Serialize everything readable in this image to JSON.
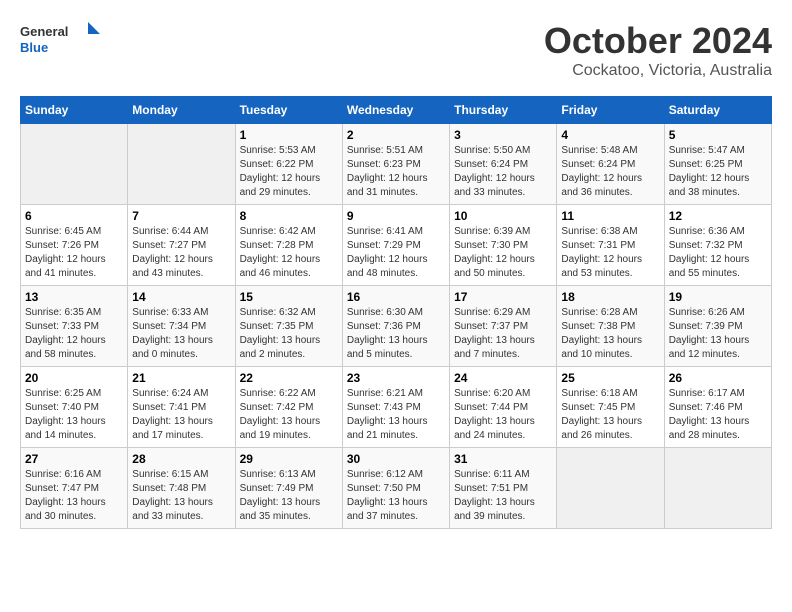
{
  "logo": {
    "line1": "General",
    "line2": "Blue"
  },
  "title": "October 2024",
  "subtitle": "Cockatoo, Victoria, Australia",
  "headers": [
    "Sunday",
    "Monday",
    "Tuesday",
    "Wednesday",
    "Thursday",
    "Friday",
    "Saturday"
  ],
  "weeks": [
    [
      {
        "day": "",
        "info": ""
      },
      {
        "day": "",
        "info": ""
      },
      {
        "day": "1",
        "sunrise": "5:53 AM",
        "sunset": "6:22 PM",
        "daylight": "12 hours and 29 minutes."
      },
      {
        "day": "2",
        "sunrise": "5:51 AM",
        "sunset": "6:23 PM",
        "daylight": "12 hours and 31 minutes."
      },
      {
        "day": "3",
        "sunrise": "5:50 AM",
        "sunset": "6:24 PM",
        "daylight": "12 hours and 33 minutes."
      },
      {
        "day": "4",
        "sunrise": "5:48 AM",
        "sunset": "6:24 PM",
        "daylight": "12 hours and 36 minutes."
      },
      {
        "day": "5",
        "sunrise": "5:47 AM",
        "sunset": "6:25 PM",
        "daylight": "12 hours and 38 minutes."
      }
    ],
    [
      {
        "day": "6",
        "sunrise": "6:45 AM",
        "sunset": "7:26 PM",
        "daylight": "12 hours and 41 minutes."
      },
      {
        "day": "7",
        "sunrise": "6:44 AM",
        "sunset": "7:27 PM",
        "daylight": "12 hours and 43 minutes."
      },
      {
        "day": "8",
        "sunrise": "6:42 AM",
        "sunset": "7:28 PM",
        "daylight": "12 hours and 46 minutes."
      },
      {
        "day": "9",
        "sunrise": "6:41 AM",
        "sunset": "7:29 PM",
        "daylight": "12 hours and 48 minutes."
      },
      {
        "day": "10",
        "sunrise": "6:39 AM",
        "sunset": "7:30 PM",
        "daylight": "12 hours and 50 minutes."
      },
      {
        "day": "11",
        "sunrise": "6:38 AM",
        "sunset": "7:31 PM",
        "daylight": "12 hours and 53 minutes."
      },
      {
        "day": "12",
        "sunrise": "6:36 AM",
        "sunset": "7:32 PM",
        "daylight": "12 hours and 55 minutes."
      }
    ],
    [
      {
        "day": "13",
        "sunrise": "6:35 AM",
        "sunset": "7:33 PM",
        "daylight": "12 hours and 58 minutes."
      },
      {
        "day": "14",
        "sunrise": "6:33 AM",
        "sunset": "7:34 PM",
        "daylight": "13 hours and 0 minutes."
      },
      {
        "day": "15",
        "sunrise": "6:32 AM",
        "sunset": "7:35 PM",
        "daylight": "13 hours and 2 minutes."
      },
      {
        "day": "16",
        "sunrise": "6:30 AM",
        "sunset": "7:36 PM",
        "daylight": "13 hours and 5 minutes."
      },
      {
        "day": "17",
        "sunrise": "6:29 AM",
        "sunset": "7:37 PM",
        "daylight": "13 hours and 7 minutes."
      },
      {
        "day": "18",
        "sunrise": "6:28 AM",
        "sunset": "7:38 PM",
        "daylight": "13 hours and 10 minutes."
      },
      {
        "day": "19",
        "sunrise": "6:26 AM",
        "sunset": "7:39 PM",
        "daylight": "13 hours and 12 minutes."
      }
    ],
    [
      {
        "day": "20",
        "sunrise": "6:25 AM",
        "sunset": "7:40 PM",
        "daylight": "13 hours and 14 minutes."
      },
      {
        "day": "21",
        "sunrise": "6:24 AM",
        "sunset": "7:41 PM",
        "daylight": "13 hours and 17 minutes."
      },
      {
        "day": "22",
        "sunrise": "6:22 AM",
        "sunset": "7:42 PM",
        "daylight": "13 hours and 19 minutes."
      },
      {
        "day": "23",
        "sunrise": "6:21 AM",
        "sunset": "7:43 PM",
        "daylight": "13 hours and 21 minutes."
      },
      {
        "day": "24",
        "sunrise": "6:20 AM",
        "sunset": "7:44 PM",
        "daylight": "13 hours and 24 minutes."
      },
      {
        "day": "25",
        "sunrise": "6:18 AM",
        "sunset": "7:45 PM",
        "daylight": "13 hours and 26 minutes."
      },
      {
        "day": "26",
        "sunrise": "6:17 AM",
        "sunset": "7:46 PM",
        "daylight": "13 hours and 28 minutes."
      }
    ],
    [
      {
        "day": "27",
        "sunrise": "6:16 AM",
        "sunset": "7:47 PM",
        "daylight": "13 hours and 30 minutes."
      },
      {
        "day": "28",
        "sunrise": "6:15 AM",
        "sunset": "7:48 PM",
        "daylight": "13 hours and 33 minutes."
      },
      {
        "day": "29",
        "sunrise": "6:13 AM",
        "sunset": "7:49 PM",
        "daylight": "13 hours and 35 minutes."
      },
      {
        "day": "30",
        "sunrise": "6:12 AM",
        "sunset": "7:50 PM",
        "daylight": "13 hours and 37 minutes."
      },
      {
        "day": "31",
        "sunrise": "6:11 AM",
        "sunset": "7:51 PM",
        "daylight": "13 hours and 39 minutes."
      },
      {
        "day": "",
        "info": ""
      },
      {
        "day": "",
        "info": ""
      }
    ]
  ],
  "labels": {
    "sunrise": "Sunrise:",
    "sunset": "Sunset:",
    "daylight": "Daylight:"
  }
}
